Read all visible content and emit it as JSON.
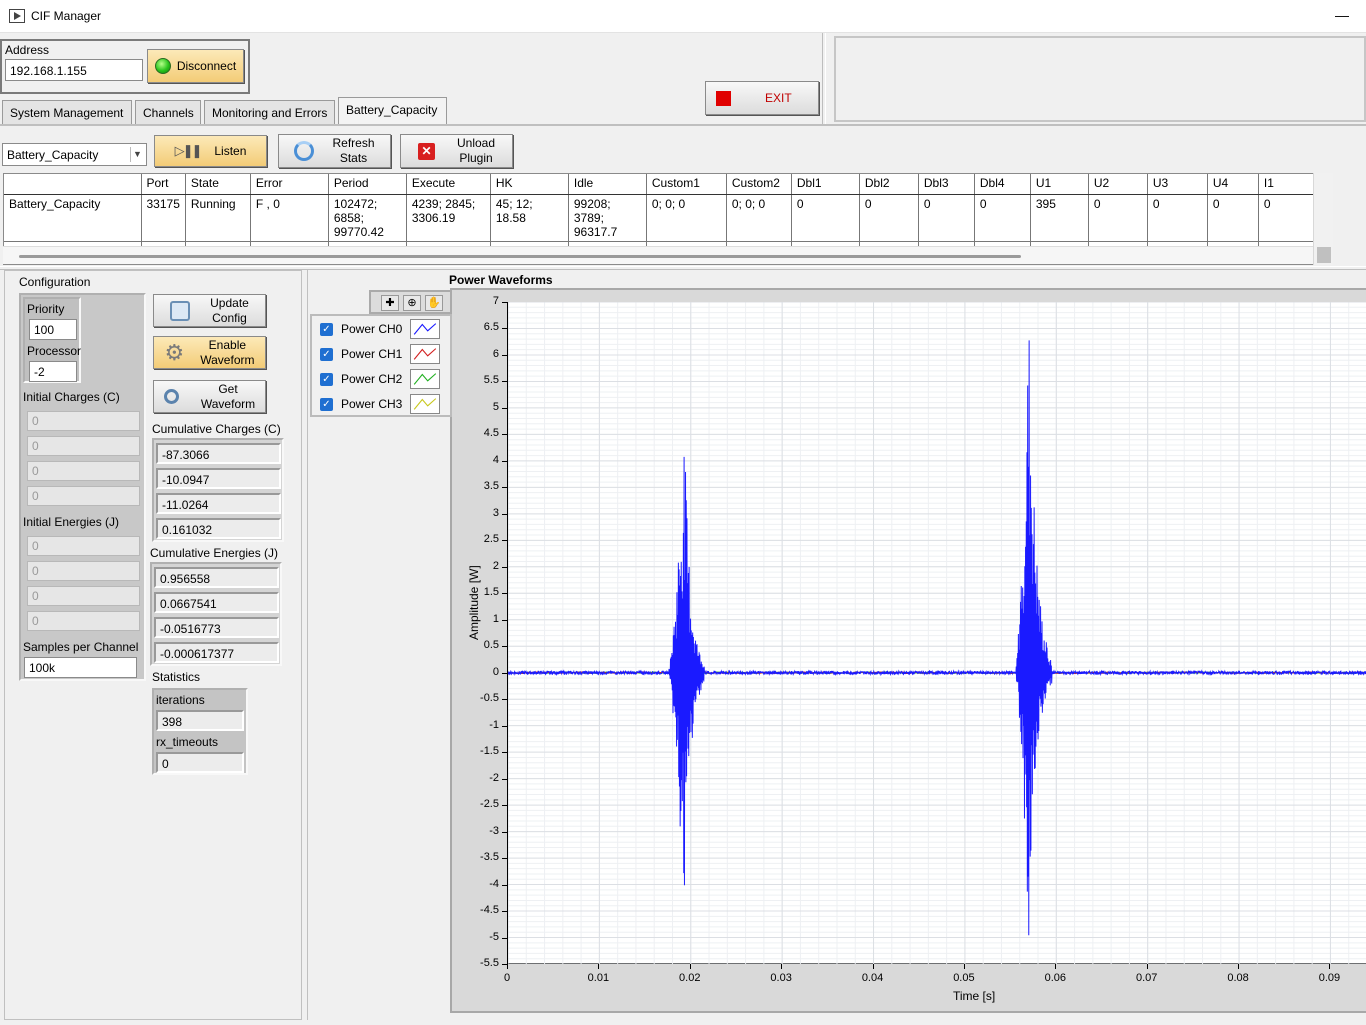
{
  "window": {
    "title": "CIF Manager",
    "minimize_glyph": "—"
  },
  "connection": {
    "address_label": "Address",
    "address_value": "192.168.1.155",
    "disconnect_label": "Disconnect",
    "led_color": "#29c41c"
  },
  "exit_label": "EXIT",
  "tabs": [
    {
      "label": "System Management",
      "active": false
    },
    {
      "label": "Channels",
      "active": false
    },
    {
      "label": "Monitoring and Errors",
      "active": false
    },
    {
      "label": "Battery_Capacity",
      "active": true
    }
  ],
  "toolbar": {
    "plugin_select": "Battery_Capacity",
    "listen_label": "Listen",
    "refresh_label_1": "Refresh",
    "refresh_label_2": "Stats",
    "unload_label_1": "Unload",
    "unload_label_2": "Plugin"
  },
  "table": {
    "columns": [
      "",
      "Port",
      "State",
      "Error",
      "Period",
      "Execute",
      "HK",
      "Idle",
      "Custom1",
      "Custom2",
      "Dbl1",
      "Dbl2",
      "Dbl3",
      "Dbl4",
      "U1",
      "U2",
      "U3",
      "U4",
      "I1"
    ],
    "rows": [
      [
        "Battery_Capacity",
        "33175",
        "Running",
        "F , 0",
        "102472;  6858;  99770.42",
        "4239;  2845;  3306.19",
        "45;  12;  18.58",
        "99208;  3789;  96317.7",
        "0;  0;  0",
        "0;  0;  0",
        "0",
        "0",
        "0",
        "0",
        "395",
        "0",
        "0",
        "0",
        "0"
      ]
    ]
  },
  "config": {
    "title": "Configuration",
    "priority_label": "Priority",
    "priority_value": "100",
    "processor_label": "Processor",
    "processor_value": "-2",
    "initial_charges_label": "Initial Charges (C)",
    "initial_charges": [
      "0",
      "0",
      "0",
      "0"
    ],
    "initial_energies_label": "Initial Energies (J)",
    "initial_energies": [
      "0",
      "0",
      "0",
      "0"
    ],
    "samples_label": "Samples per Channel",
    "samples_value": "100k",
    "update_config_1": "Update",
    "update_config_2": "Config",
    "enable_waveform_1": "Enable",
    "enable_waveform_2": "Waveform",
    "get_waveform_1": "Get",
    "get_waveform_2": "Waveform",
    "cumulative_charges_label": "Cumulative Charges (C)",
    "cumulative_charges": [
      "-87.3066",
      "-10.0947",
      "-11.0264",
      "0.161032"
    ],
    "cumulative_energies_label": "Cumulative Energies (J)",
    "cumulative_energies": [
      "0.956558",
      "0.0667541",
      "-0.0516773",
      "-0.000617377"
    ],
    "statistics_label": "Statistics",
    "iterations_label": "iterations",
    "iterations_value": "398",
    "rx_timeouts_label": "rx_timeouts",
    "rx_timeouts_value": "0"
  },
  "chart_data": {
    "type": "line",
    "title": "Power Waveforms",
    "xlabel": "Time [s]",
    "ylabel": "Amplitude [W]",
    "xlim": [
      0,
      0.094
    ],
    "ylim": [
      -5.5,
      7
    ],
    "xticks": [
      "0",
      "0.01",
      "0.02",
      "0.03",
      "0.04",
      "0.05",
      "0.06",
      "0.07",
      "0.08",
      "0.09"
    ],
    "yticks": [
      "7",
      "6.5",
      "6",
      "5.5",
      "5",
      "4.5",
      "4",
      "3.5",
      "3",
      "2.5",
      "2",
      "1.5",
      "1",
      "0.5",
      "0",
      "-0.5",
      "-1",
      "-1.5",
      "-2",
      "-2.5",
      "-3",
      "-3.5",
      "-4",
      "-4.5",
      "-5",
      "-5.5"
    ],
    "grid": true,
    "legend_placement": "top-left",
    "series": [
      {
        "name": "Power CH0",
        "color": "#1a1aff",
        "visible": true,
        "bursts": [
          {
            "start": 0.0175,
            "end": 0.0215,
            "peak_t": 0.0193,
            "max": 4.6,
            "min": -4.65
          },
          {
            "start": 0.0555,
            "end": 0.0595,
            "peak_t": 0.057,
            "max": 6.7,
            "min": -5.1
          }
        ]
      },
      {
        "name": "Power CH1",
        "color": "#d22020",
        "visible": true
      },
      {
        "name": "Power CH2",
        "color": "#21b021",
        "visible": true
      },
      {
        "name": "Power CH3",
        "color": "#c8c81e",
        "visible": true
      }
    ]
  }
}
